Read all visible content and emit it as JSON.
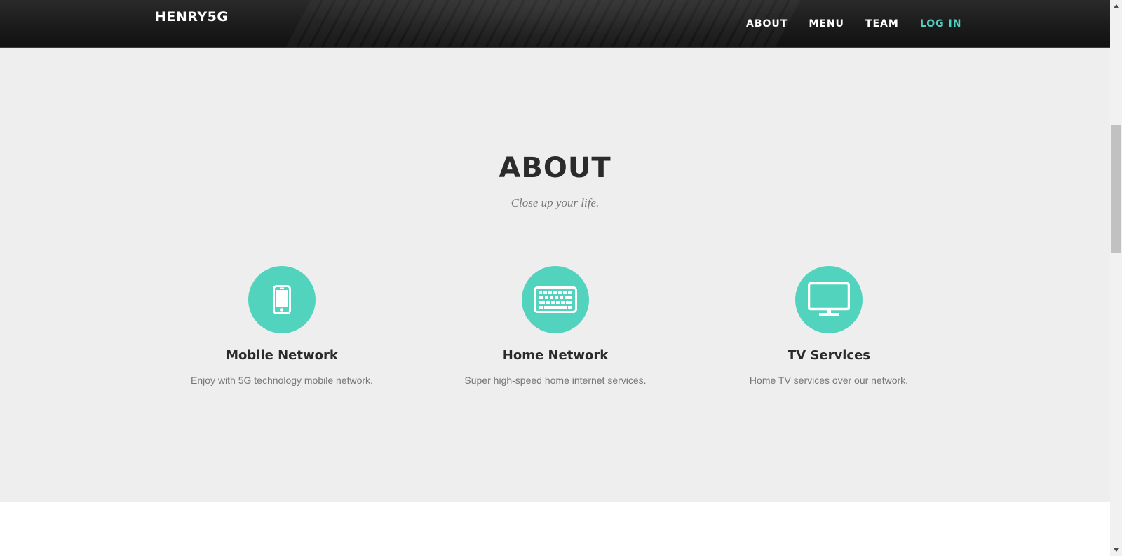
{
  "brand": {
    "name": "HENRY5G"
  },
  "nav": {
    "items": [
      {
        "label": "ABOUT"
      },
      {
        "label": "MENU"
      },
      {
        "label": "TEAM"
      },
      {
        "label": "LOG IN"
      }
    ],
    "active_color": "#4fd1c0"
  },
  "about": {
    "title": "ABOUT",
    "subtitle": "Close up your life.",
    "services": [
      {
        "icon": "mobile-phone-icon",
        "title": "Mobile Network",
        "description": "Enjoy with 5G technology mobile network."
      },
      {
        "icon": "keyboard-icon",
        "title": "Home Network",
        "description": "Super high-speed home internet services."
      },
      {
        "icon": "monitor-icon",
        "title": "TV Services",
        "description": "Home TV services over our network."
      }
    ]
  },
  "colors": {
    "accent": "#52d3bd",
    "section_bg": "#eeeeee",
    "text_dark": "#2b2b2b",
    "text_muted": "#777777"
  }
}
